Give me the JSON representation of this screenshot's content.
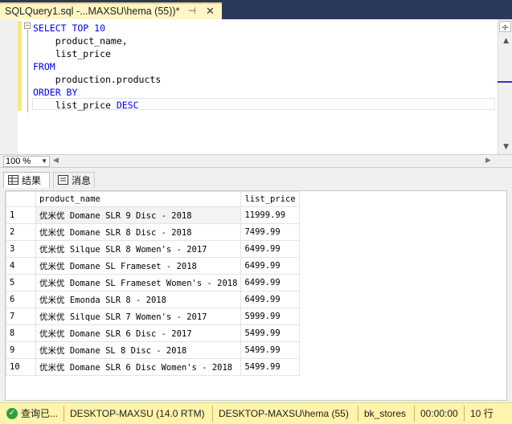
{
  "tab": {
    "title": "SQLQuery1.sql -...MAXSU\\hema (55))*",
    "pin": "⊣",
    "close": "✕"
  },
  "editor": {
    "lines": [
      [
        {
          "t": "SELECT TOP 10",
          "k": true
        }
      ],
      [
        {
          "t": "    product_name,",
          "k": false
        }
      ],
      [
        {
          "t": "    list_price",
          "k": false
        }
      ],
      [
        {
          "t": "FROM",
          "k": true
        }
      ],
      [
        {
          "t": "    production.products",
          "k": false
        }
      ],
      [
        {
          "t": "ORDER BY",
          "k": true
        }
      ],
      [
        {
          "t": "    list_price ",
          "k": false
        },
        {
          "t": "DESC",
          "k": true
        }
      ]
    ]
  },
  "zoom": {
    "value": "100 %"
  },
  "result_tabs": {
    "results": "结果",
    "messages": "消息"
  },
  "grid": {
    "columns": [
      "product_name",
      "list_price"
    ],
    "rows": [
      [
        "1",
        "优米优 Domane SLR 9 Disc - 2018",
        "11999.99"
      ],
      [
        "2",
        "优米优 Domane SLR 8 Disc - 2018",
        "7499.99"
      ],
      [
        "3",
        "优米优 Silque SLR 8 Women's - 2017",
        "6499.99"
      ],
      [
        "4",
        "优米优 Domane SL Frameset - 2018",
        "6499.99"
      ],
      [
        "5",
        "优米优 Domane SL Frameset Women's - 2018",
        "6499.99"
      ],
      [
        "6",
        "优米优 Emonda SLR 8 - 2018",
        "6499.99"
      ],
      [
        "7",
        "优米优 Silque SLR 7 Women's - 2017",
        "5999.99"
      ],
      [
        "8",
        "优米优 Domane SLR 6 Disc - 2017",
        "5499.99"
      ],
      [
        "9",
        "优米优 Domane SL 8 Disc - 2018",
        "5499.99"
      ],
      [
        "10",
        "优米优 Domane SLR 6 Disc Women's - 2018",
        "5499.99"
      ]
    ]
  },
  "status": {
    "state": "查询已...",
    "server": "DESKTOP-MAXSU (14.0 RTM)",
    "user": "DESKTOP-MAXSU\\hema (55)",
    "database": "bk_stores",
    "elapsed": "00:00:00",
    "rows": "10 行"
  },
  "colors": {
    "tab_active": "#fff6c5",
    "status_bar": "#fff4ab",
    "keyword": "#0000ff",
    "chrome": "#2b3a5c"
  }
}
